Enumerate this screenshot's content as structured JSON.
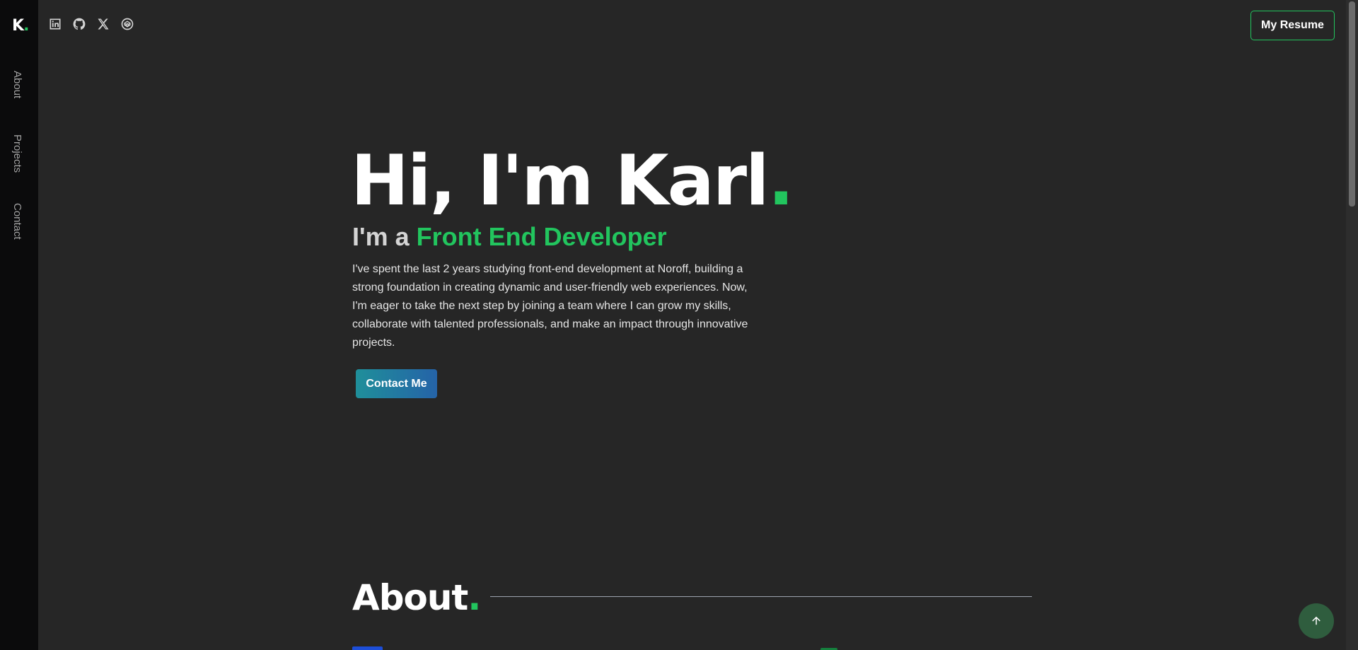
{
  "logo": {
    "letter": "K",
    "dot": "."
  },
  "sidebar": {
    "items": [
      {
        "label": "About"
      },
      {
        "label": "Projects"
      },
      {
        "label": "Contact"
      }
    ]
  },
  "socials": [
    {
      "icon": "linkedin-icon"
    },
    {
      "icon": "github-icon"
    },
    {
      "icon": "x-icon"
    },
    {
      "icon": "codepen-icon"
    }
  ],
  "header": {
    "resume_label": "My Resume"
  },
  "hero": {
    "title": "Hi, I'm Karl",
    "title_dot": ".",
    "subtitle_prefix": "I'm a ",
    "subtitle_role": "Front End Developer",
    "description": "I've spent the last 2 years studying front-end development at Noroff, building a strong foundation in creating dynamic and user-friendly web experiences. Now, I'm eager to take the next step by joining a team where I can grow my skills, collaborate with talented professionals, and make an impact through innovative projects.",
    "contact_label": "Contact Me"
  },
  "about": {
    "title": "About",
    "title_dot": "."
  },
  "colors": {
    "accent": "#22c55e",
    "background": "#262626",
    "sidebar": "#0b0b0c",
    "button_gradient_start": "#1f8f9a",
    "button_gradient_end": "#2563a8"
  }
}
